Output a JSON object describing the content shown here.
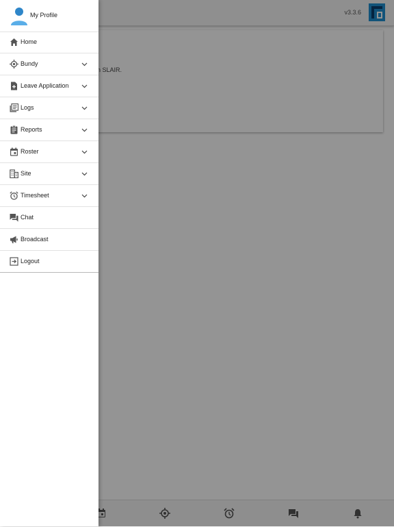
{
  "app": {
    "version": "v3.3.6",
    "card_text": "on SLAIR."
  },
  "drawer": {
    "profile_label": "My Profile",
    "items": [
      {
        "label": "Home",
        "icon": "home-icon",
        "expandable": false
      },
      {
        "label": "Bundy",
        "icon": "crosshair-icon",
        "expandable": true
      },
      {
        "label": "Leave Application",
        "icon": "file-plus-icon",
        "expandable": true
      },
      {
        "label": "Logs",
        "icon": "library-icon",
        "expandable": true
      },
      {
        "label": "Reports",
        "icon": "clipboard-icon",
        "expandable": true
      },
      {
        "label": "Roster",
        "icon": "calendar-icon",
        "expandable": true
      },
      {
        "label": "Site",
        "icon": "building-icon",
        "expandable": true
      },
      {
        "label": "Timesheet",
        "icon": "alarm-icon",
        "expandable": true
      },
      {
        "label": "Chat",
        "icon": "chat-icon",
        "expandable": false
      },
      {
        "label": "Broadcast",
        "icon": "megaphone-icon",
        "expandable": false
      },
      {
        "label": "Logout",
        "icon": "logout-icon",
        "expandable": false
      }
    ]
  },
  "bottom_nav": [
    "calendar-icon",
    "crosshair-icon",
    "alarm-icon",
    "chat-icon",
    "bell-icon"
  ],
  "colors": {
    "accent": "#1f8fd0",
    "icon": "#555555",
    "overlay": "rgba(0,0,0,0.42)"
  }
}
